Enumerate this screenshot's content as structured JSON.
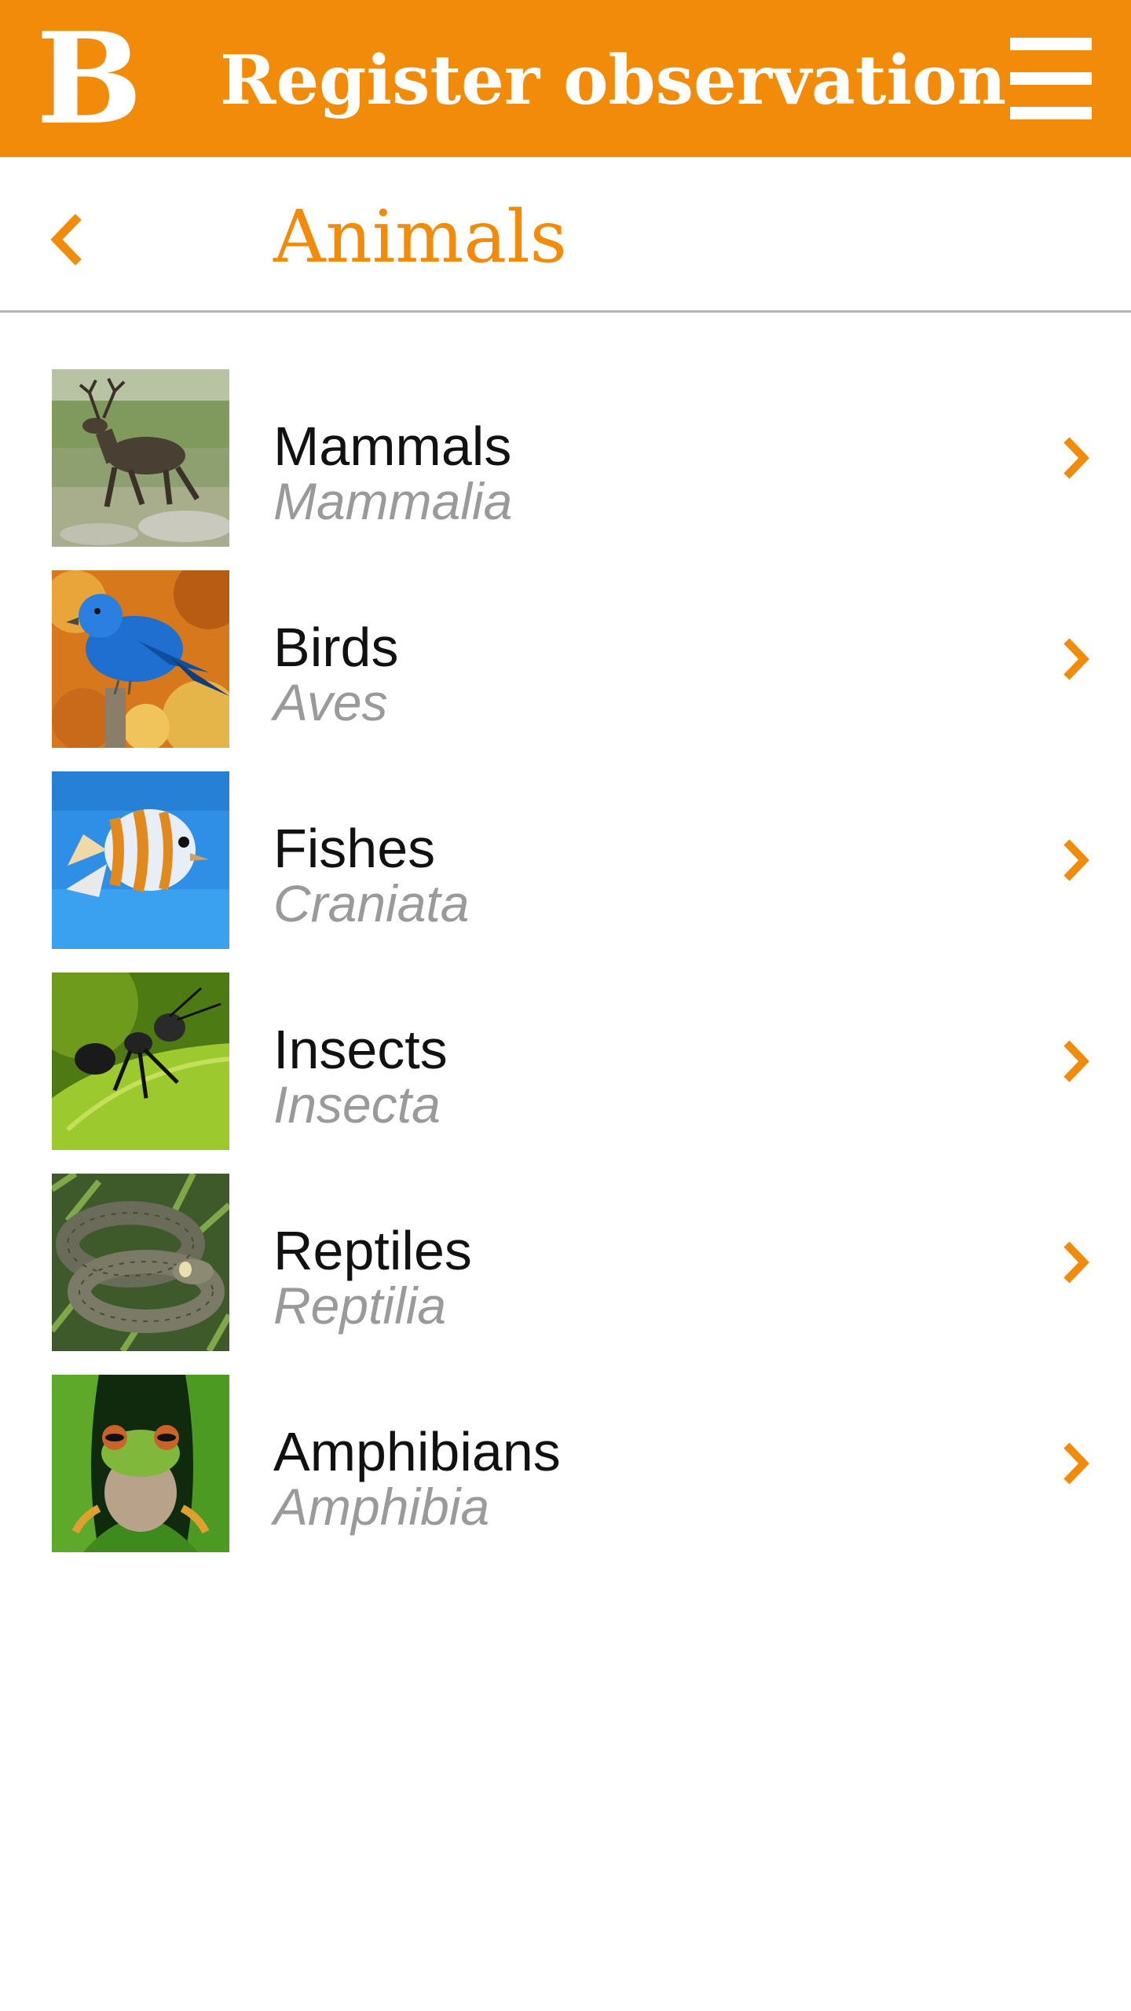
{
  "appbar": {
    "logo_text": "B",
    "title": "Register observation",
    "menu_icon": "hamburger-menu-icon",
    "color": "#f28a0a"
  },
  "subheader": {
    "back_icon": "chevron-left-icon",
    "title": "Animals"
  },
  "categories": [
    {
      "name": "Mammals",
      "latin": "Mammalia",
      "image": "reindeer"
    },
    {
      "name": "Birds",
      "latin": "Aves",
      "image": "blue-bird"
    },
    {
      "name": "Fishes",
      "latin": "Craniata",
      "image": "butterflyfish"
    },
    {
      "name": "Insects",
      "latin": "Insecta",
      "image": "ant"
    },
    {
      "name": "Reptiles",
      "latin": "Reptilia",
      "image": "snake"
    },
    {
      "name": "Amphibians",
      "latin": "Amphibia",
      "image": "tree-frog"
    }
  ],
  "colors": {
    "accent": "#f28a0a",
    "secondary_text": "#9a9a9a",
    "divider": "#b5b5b5"
  }
}
